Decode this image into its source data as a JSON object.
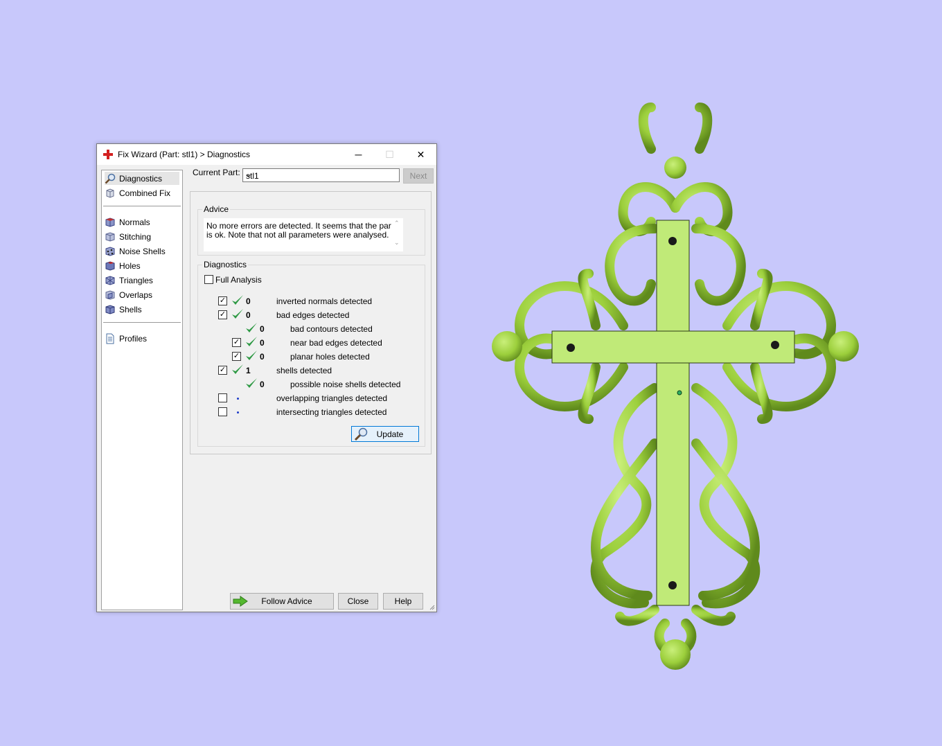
{
  "dialog": {
    "title": "Fix Wizard (Part: stl1) > Diagnostics",
    "window_controls": {
      "minimize": "─",
      "maximize": "☐",
      "close": "✕"
    }
  },
  "nav": {
    "items_top": [
      {
        "label": "Diagnostics",
        "icon": "magnifier-icon",
        "selected": true
      },
      {
        "label": "Combined Fix",
        "icon": "cube-icon"
      }
    ],
    "items_mid": [
      {
        "label": "Normals",
        "icon": "normals-cube-icon"
      },
      {
        "label": "Stitching",
        "icon": "stitching-cube-icon"
      },
      {
        "label": "Noise Shells",
        "icon": "noise-shells-icon"
      },
      {
        "label": "Holes",
        "icon": "holes-cube-icon"
      },
      {
        "label": "Triangles",
        "icon": "triangles-cube-icon"
      },
      {
        "label": "Overlaps",
        "icon": "overlaps-cube-icon"
      },
      {
        "label": "Shells",
        "icon": "shells-cube-icon"
      }
    ],
    "items_bottom": [
      {
        "label": "Profiles",
        "icon": "document-icon"
      }
    ]
  },
  "current_part": {
    "label": "Current Part:",
    "value": "stl1",
    "next_label": "Next"
  },
  "advice": {
    "title": "Advice",
    "text": "No more errors are detected. It seems that the part is ok. Note that not all parameters were analysed."
  },
  "diagnostics": {
    "title": "Diagnostics",
    "full_analysis_label": "Full Analysis",
    "full_analysis_checked": false,
    "rows": [
      {
        "checked": true,
        "status": "ok",
        "count": "0",
        "label": "inverted normals detected",
        "indent": 0
      },
      {
        "checked": true,
        "status": "ok",
        "count": "0",
        "label": "bad edges detected",
        "indent": 0
      },
      {
        "checked": null,
        "status": "ok",
        "count": "0",
        "label": "bad contours detected",
        "indent": 1
      },
      {
        "checked": true,
        "status": "ok",
        "count": "0",
        "label": "near bad edges detected",
        "indent": 1
      },
      {
        "checked": true,
        "status": "ok",
        "count": "0",
        "label": "planar holes detected",
        "indent": 1
      },
      {
        "checked": true,
        "status": "ok",
        "count": "1",
        "label": "shells detected",
        "indent": 0
      },
      {
        "checked": null,
        "status": "ok",
        "count": "0",
        "label": "possible noise shells detected",
        "indent": 1
      },
      {
        "checked": false,
        "status": "unknown",
        "count": "",
        "label": "overlapping triangles detected",
        "indent": 0
      },
      {
        "checked": false,
        "status": "unknown",
        "count": "",
        "label": "intersecting triangles detected",
        "indent": 0
      }
    ],
    "update_label": "Update"
  },
  "footer": {
    "follow_advice_label": "Follow Advice",
    "close_label": "Close",
    "help_label": "Help"
  },
  "colors": {
    "background": "#c8c8fb",
    "model_green": "#9ccf3c",
    "check_green": "#2f9a45"
  }
}
